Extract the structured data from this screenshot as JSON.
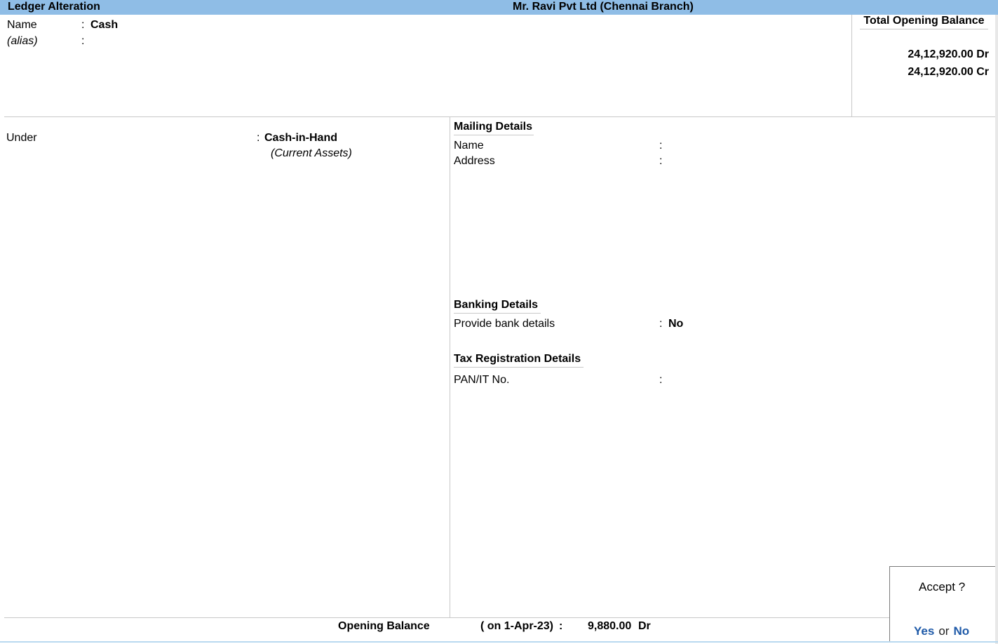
{
  "titlebar": {
    "screen_title": "Ledger Alteration",
    "company": "Mr. Ravi Pvt Ltd (Chennai Branch)"
  },
  "header": {
    "name_label": "Name",
    "name_value": "Cash",
    "alias_label": "(alias)",
    "colon": ":"
  },
  "total_opening": {
    "title": "Total Opening Balance",
    "dr": "24,12,920.00 Dr",
    "cr": "24,12,920.00 Cr"
  },
  "left": {
    "under_label": "Under",
    "under_value": "Cash-in-Hand",
    "under_parent": "(Current Assets)"
  },
  "mailing": {
    "heading": "Mailing Details",
    "name_label": "Name",
    "address_label": "Address"
  },
  "banking": {
    "heading": "Banking Details",
    "provide_label": "Provide bank details",
    "provide_value": "No"
  },
  "tax": {
    "heading": "Tax Registration Details",
    "pan_label": "PAN/IT No."
  },
  "footer": {
    "label": "Opening Balance",
    "date": "( on 1-Apr-23)",
    "colon": ":",
    "amount": "9,880.00",
    "drcr": "Dr"
  },
  "accept": {
    "question": "Accept ?",
    "yes": "Yes",
    "or": "or",
    "no": "No"
  }
}
